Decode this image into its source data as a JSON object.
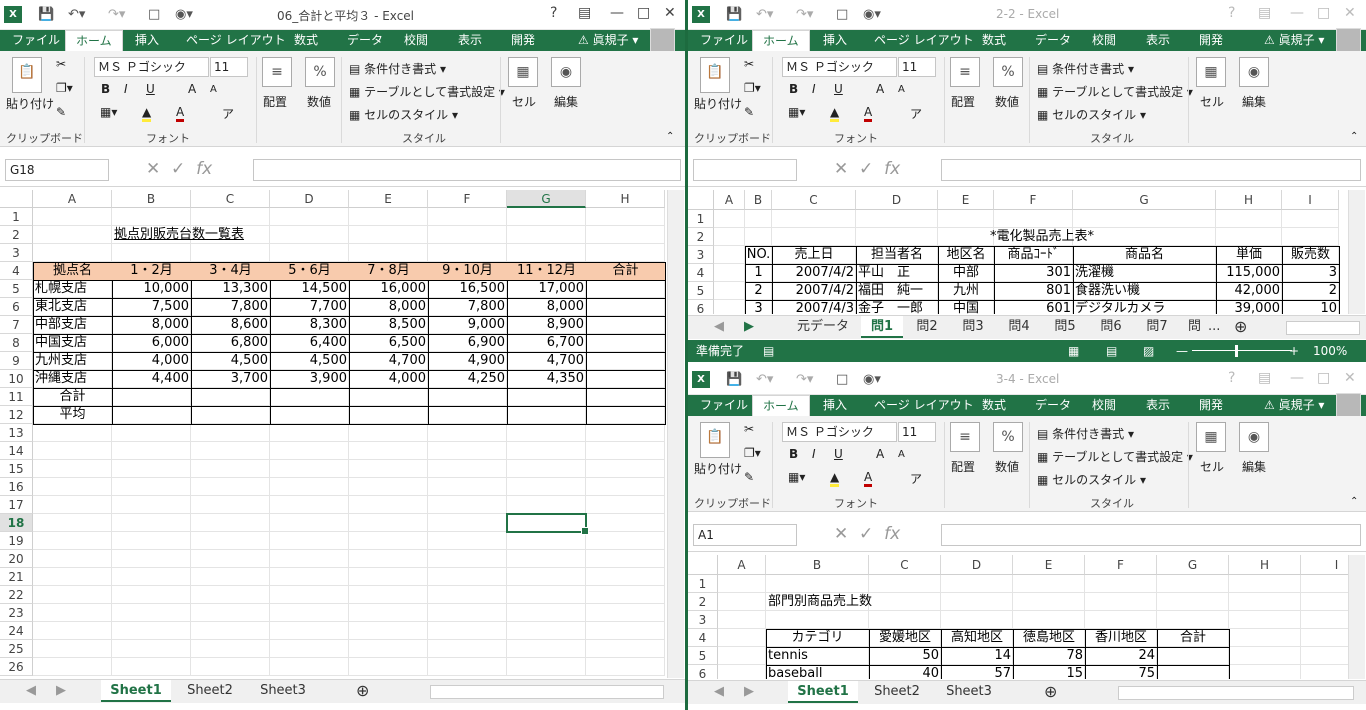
{
  "colors": {
    "accent": "#217346",
    "header_fill": "#f8cbad"
  },
  "user_name": "眞規子",
  "ribbon": {
    "paste": "貼り付け",
    "font_name": "ＭＳ Ｐゴシック",
    "font_size": "11",
    "bold": "B",
    "italic": "I",
    "underline": "U",
    "grow": "A",
    "shrink": "A",
    "align": "配置",
    "number": "数値",
    "percent": "%",
    "cond_format": "条件付き書式",
    "table_format": "テーブルとして書式設定",
    "cell_style": "セルのスタイル",
    "cells": "セル",
    "editing": "編集",
    "grp_clipboard": "クリップボード",
    "grp_font": "フォント",
    "grp_style": "スタイル"
  },
  "tabs": {
    "file": "ファイル",
    "home": "ホーム",
    "insert": "挿入",
    "layout": "ページ レイアウト",
    "formulas": "数式",
    "data": "データ",
    "review": "校閲",
    "view": "表示",
    "developer": "開発"
  },
  "left": {
    "title": "06_合計と平均３ - Excel",
    "namebox": "G18",
    "columns": [
      "A",
      "B",
      "C",
      "D",
      "E",
      "F",
      "G",
      "H"
    ],
    "rows": [
      "1",
      "2",
      "3",
      "4",
      "5",
      "6",
      "7",
      "8",
      "9",
      "10",
      "11",
      "12",
      "13",
      "14",
      "15",
      "16",
      "17",
      "18",
      "19",
      "20",
      "21",
      "22",
      "23",
      "24",
      "25",
      "26"
    ],
    "sheet_title": "拠点別販売台数一覧表",
    "headers": [
      "拠点名",
      "1・2月",
      "3・4月",
      "5・6月",
      "7・8月",
      "9・10月",
      "11・12月",
      "合計"
    ],
    "data": [
      [
        "札幌支店",
        "10,000",
        "13,300",
        "14,500",
        "16,000",
        "16,500",
        "17,000"
      ],
      [
        "東北支店",
        "7,500",
        "7,800",
        "7,700",
        "8,000",
        "7,800",
        "8,000"
      ],
      [
        "中部支店",
        "8,000",
        "8,600",
        "8,300",
        "8,500",
        "9,000",
        "8,900"
      ],
      [
        "中国支店",
        "6,000",
        "6,800",
        "6,400",
        "6,500",
        "6,900",
        "6,700"
      ],
      [
        "九州支店",
        "4,000",
        "4,500",
        "4,500",
        "4,700",
        "4,900",
        "4,700"
      ],
      [
        "沖縄支店",
        "4,400",
        "3,700",
        "3,900",
        "4,000",
        "4,250",
        "4,350"
      ]
    ],
    "total_label": "合計",
    "avg_label": "平均",
    "sheets": [
      "Sheet1",
      "Sheet2",
      "Sheet3"
    ]
  },
  "right_top": {
    "title": "2-2 - Excel",
    "columns": [
      "A",
      "B",
      "C",
      "D",
      "E",
      "F",
      "G",
      "H",
      "I"
    ],
    "rows": [
      "1",
      "2",
      "3",
      "4",
      "5",
      "6"
    ],
    "sheet_title": "*電化製品売上表*",
    "headers": [
      "NO.",
      "売上日",
      "担当者名",
      "地区名",
      "商品ｺｰﾄﾞ",
      "商品名",
      "単価",
      "販売数"
    ],
    "data": [
      [
        "1",
        "2007/4/2",
        "平山　正",
        "中部",
        "301",
        "洗濯機",
        "115,000",
        "3"
      ],
      [
        "2",
        "2007/4/2",
        "福田　純一",
        "九州",
        "801",
        "食器洗い機",
        "42,000",
        "2"
      ],
      [
        "3",
        "2007/4/3",
        "金子　一郎",
        "中国",
        "601",
        "デジタルカメラ",
        "39,000",
        "10"
      ]
    ],
    "sheets": [
      "元データ",
      "問1",
      "問2",
      "問3",
      "問4",
      "問5",
      "問6",
      "問7",
      "問"
    ],
    "status": "準備完了",
    "zoom": "100%"
  },
  "right_bottom": {
    "title": "3-4 - Excel",
    "namebox": "A1",
    "columns": [
      "A",
      "B",
      "C",
      "D",
      "E",
      "F",
      "G",
      "H",
      "I"
    ],
    "rows": [
      "1",
      "2",
      "3",
      "4",
      "5",
      "6"
    ],
    "sheet_title": "部門別商品売上数",
    "headers": [
      "カテゴリ",
      "愛媛地区",
      "高知地区",
      "徳島地区",
      "香川地区",
      "合計"
    ],
    "data": [
      [
        "tennis",
        "50",
        "14",
        "78",
        "24"
      ],
      [
        "baseball",
        "40",
        "57",
        "15",
        "75"
      ]
    ],
    "sheets": [
      "Sheet1",
      "Sheet2",
      "Sheet3"
    ]
  }
}
